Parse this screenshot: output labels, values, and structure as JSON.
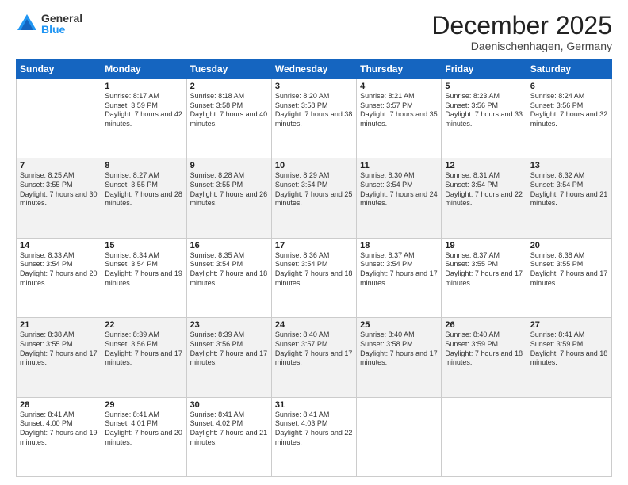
{
  "logo": {
    "general": "General",
    "blue": "Blue"
  },
  "header": {
    "month": "December 2025",
    "location": "Daenischenhagen, Germany"
  },
  "weekdays": [
    "Sunday",
    "Monday",
    "Tuesday",
    "Wednesday",
    "Thursday",
    "Friday",
    "Saturday"
  ],
  "weeks": [
    [
      {
        "day": "",
        "sunrise": "",
        "sunset": "",
        "daylight": ""
      },
      {
        "day": "1",
        "sunrise": "Sunrise: 8:17 AM",
        "sunset": "Sunset: 3:59 PM",
        "daylight": "Daylight: 7 hours and 42 minutes."
      },
      {
        "day": "2",
        "sunrise": "Sunrise: 8:18 AM",
        "sunset": "Sunset: 3:58 PM",
        "daylight": "Daylight: 7 hours and 40 minutes."
      },
      {
        "day": "3",
        "sunrise": "Sunrise: 8:20 AM",
        "sunset": "Sunset: 3:58 PM",
        "daylight": "Daylight: 7 hours and 38 minutes."
      },
      {
        "day": "4",
        "sunrise": "Sunrise: 8:21 AM",
        "sunset": "Sunset: 3:57 PM",
        "daylight": "Daylight: 7 hours and 35 minutes."
      },
      {
        "day": "5",
        "sunrise": "Sunrise: 8:23 AM",
        "sunset": "Sunset: 3:56 PM",
        "daylight": "Daylight: 7 hours and 33 minutes."
      },
      {
        "day": "6",
        "sunrise": "Sunrise: 8:24 AM",
        "sunset": "Sunset: 3:56 PM",
        "daylight": "Daylight: 7 hours and 32 minutes."
      }
    ],
    [
      {
        "day": "7",
        "sunrise": "Sunrise: 8:25 AM",
        "sunset": "Sunset: 3:55 PM",
        "daylight": "Daylight: 7 hours and 30 minutes."
      },
      {
        "day": "8",
        "sunrise": "Sunrise: 8:27 AM",
        "sunset": "Sunset: 3:55 PM",
        "daylight": "Daylight: 7 hours and 28 minutes."
      },
      {
        "day": "9",
        "sunrise": "Sunrise: 8:28 AM",
        "sunset": "Sunset: 3:55 PM",
        "daylight": "Daylight: 7 hours and 26 minutes."
      },
      {
        "day": "10",
        "sunrise": "Sunrise: 8:29 AM",
        "sunset": "Sunset: 3:54 PM",
        "daylight": "Daylight: 7 hours and 25 minutes."
      },
      {
        "day": "11",
        "sunrise": "Sunrise: 8:30 AM",
        "sunset": "Sunset: 3:54 PM",
        "daylight": "Daylight: 7 hours and 24 minutes."
      },
      {
        "day": "12",
        "sunrise": "Sunrise: 8:31 AM",
        "sunset": "Sunset: 3:54 PM",
        "daylight": "Daylight: 7 hours and 22 minutes."
      },
      {
        "day": "13",
        "sunrise": "Sunrise: 8:32 AM",
        "sunset": "Sunset: 3:54 PM",
        "daylight": "Daylight: 7 hours and 21 minutes."
      }
    ],
    [
      {
        "day": "14",
        "sunrise": "Sunrise: 8:33 AM",
        "sunset": "Sunset: 3:54 PM",
        "daylight": "Daylight: 7 hours and 20 minutes."
      },
      {
        "day": "15",
        "sunrise": "Sunrise: 8:34 AM",
        "sunset": "Sunset: 3:54 PM",
        "daylight": "Daylight: 7 hours and 19 minutes."
      },
      {
        "day": "16",
        "sunrise": "Sunrise: 8:35 AM",
        "sunset": "Sunset: 3:54 PM",
        "daylight": "Daylight: 7 hours and 18 minutes."
      },
      {
        "day": "17",
        "sunrise": "Sunrise: 8:36 AM",
        "sunset": "Sunset: 3:54 PM",
        "daylight": "Daylight: 7 hours and 18 minutes."
      },
      {
        "day": "18",
        "sunrise": "Sunrise: 8:37 AM",
        "sunset": "Sunset: 3:54 PM",
        "daylight": "Daylight: 7 hours and 17 minutes."
      },
      {
        "day": "19",
        "sunrise": "Sunrise: 8:37 AM",
        "sunset": "Sunset: 3:55 PM",
        "daylight": "Daylight: 7 hours and 17 minutes."
      },
      {
        "day": "20",
        "sunrise": "Sunrise: 8:38 AM",
        "sunset": "Sunset: 3:55 PM",
        "daylight": "Daylight: 7 hours and 17 minutes."
      }
    ],
    [
      {
        "day": "21",
        "sunrise": "Sunrise: 8:38 AM",
        "sunset": "Sunset: 3:55 PM",
        "daylight": "Daylight: 7 hours and 17 minutes."
      },
      {
        "day": "22",
        "sunrise": "Sunrise: 8:39 AM",
        "sunset": "Sunset: 3:56 PM",
        "daylight": "Daylight: 7 hours and 17 minutes."
      },
      {
        "day": "23",
        "sunrise": "Sunrise: 8:39 AM",
        "sunset": "Sunset: 3:56 PM",
        "daylight": "Daylight: 7 hours and 17 minutes."
      },
      {
        "day": "24",
        "sunrise": "Sunrise: 8:40 AM",
        "sunset": "Sunset: 3:57 PM",
        "daylight": "Daylight: 7 hours and 17 minutes."
      },
      {
        "day": "25",
        "sunrise": "Sunrise: 8:40 AM",
        "sunset": "Sunset: 3:58 PM",
        "daylight": "Daylight: 7 hours and 17 minutes."
      },
      {
        "day": "26",
        "sunrise": "Sunrise: 8:40 AM",
        "sunset": "Sunset: 3:59 PM",
        "daylight": "Daylight: 7 hours and 18 minutes."
      },
      {
        "day": "27",
        "sunrise": "Sunrise: 8:41 AM",
        "sunset": "Sunset: 3:59 PM",
        "daylight": "Daylight: 7 hours and 18 minutes."
      }
    ],
    [
      {
        "day": "28",
        "sunrise": "Sunrise: 8:41 AM",
        "sunset": "Sunset: 4:00 PM",
        "daylight": "Daylight: 7 hours and 19 minutes."
      },
      {
        "day": "29",
        "sunrise": "Sunrise: 8:41 AM",
        "sunset": "Sunset: 4:01 PM",
        "daylight": "Daylight: 7 hours and 20 minutes."
      },
      {
        "day": "30",
        "sunrise": "Sunrise: 8:41 AM",
        "sunset": "Sunset: 4:02 PM",
        "daylight": "Daylight: 7 hours and 21 minutes."
      },
      {
        "day": "31",
        "sunrise": "Sunrise: 8:41 AM",
        "sunset": "Sunset: 4:03 PM",
        "daylight": "Daylight: 7 hours and 22 minutes."
      },
      {
        "day": "",
        "sunrise": "",
        "sunset": "",
        "daylight": ""
      },
      {
        "day": "",
        "sunrise": "",
        "sunset": "",
        "daylight": ""
      },
      {
        "day": "",
        "sunrise": "",
        "sunset": "",
        "daylight": ""
      }
    ]
  ]
}
